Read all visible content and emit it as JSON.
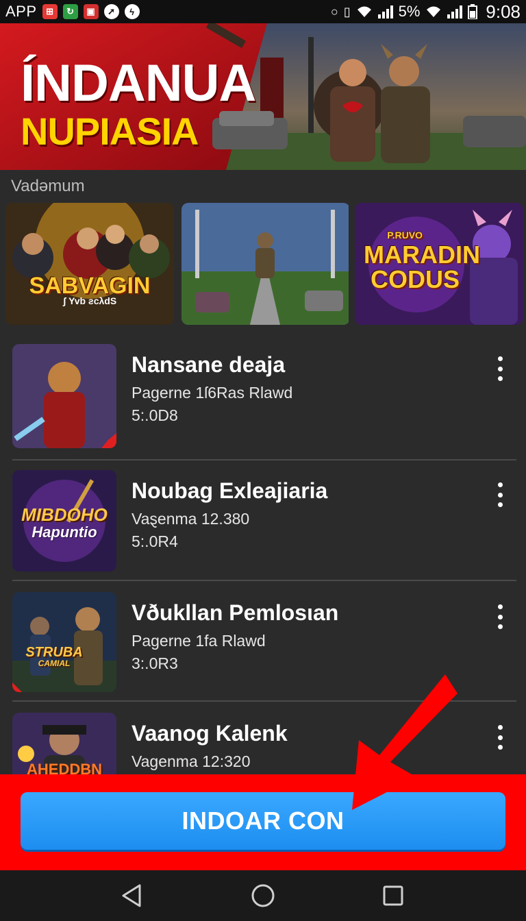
{
  "status_bar": {
    "app_label": "APP",
    "battery": "5%",
    "time": "9:08"
  },
  "hero": {
    "title_line1": "ÍNDANUA",
    "title_line2": "NUPIASIA"
  },
  "featured": {
    "section_title": "Vadəmum",
    "cards": [
      {
        "label": "SABVAGIN",
        "sublabel": "ʃ Yvb ƨcλdS"
      },
      {
        "label": ""
      },
      {
        "label_line1": "P.RUVO",
        "label_line2": "MARADIN",
        "label_line3": "CODUS"
      }
    ]
  },
  "list": {
    "items": [
      {
        "title": "Nansane deaja",
        "subtitle": "Pagerne 1ſ6Ras Rlawd",
        "size": "5:.0D8",
        "thumb_text": ""
      },
      {
        "title": "Noubag Exleajiaria",
        "subtitle": "Vaȿenma 12.380",
        "size": "5:.0R4",
        "thumb_text": "MIBDOHO",
        "thumb_text2": "Hapuntio"
      },
      {
        "title": "Vðukllan Pemlosιan",
        "subtitle": "Pagerne 1fa Rlawd",
        "size": "3:.0R3",
        "thumb_text": "STRUBA",
        "thumb_text2": "CAMIAL"
      },
      {
        "title": "Vaanog Kalenk",
        "subtitle": "Vagenma 12:320",
        "size": "",
        "thumb_text": "AHEDDBN"
      }
    ]
  },
  "cta": {
    "label": "INDOAR CON"
  },
  "colors": {
    "app_background": "#2b2b2b",
    "cta_background": "#ff0000",
    "cta_button": "#1d8ef0",
    "hero_red": "#c4121a",
    "hero_yellow": "#ffd400"
  }
}
